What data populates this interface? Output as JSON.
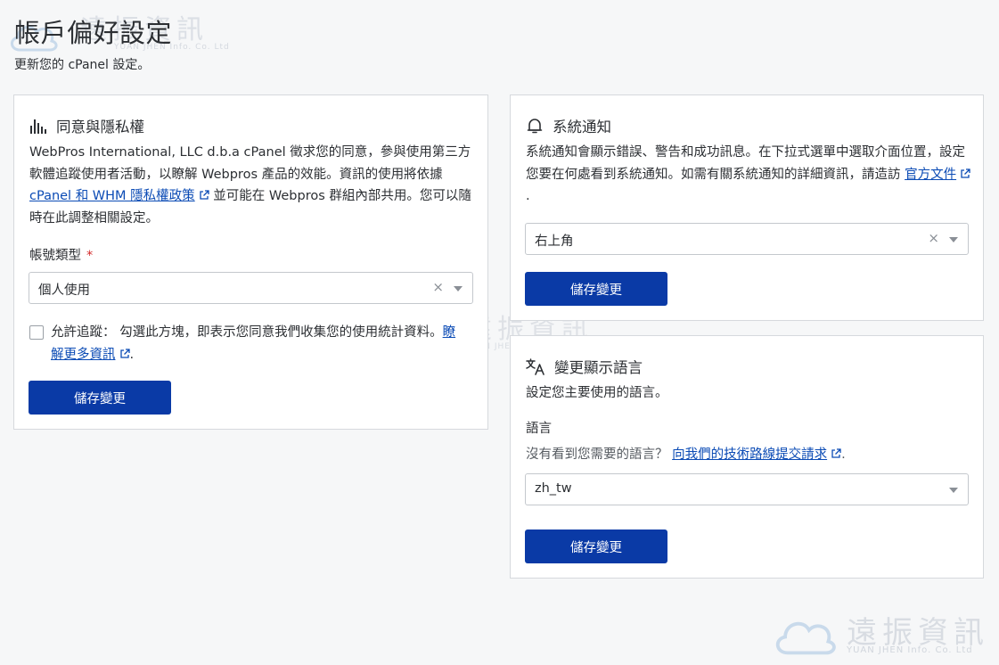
{
  "page": {
    "title": "帳戶偏好設定",
    "subtitle": "更新您的 cPanel 設定。"
  },
  "watermark": {
    "brand": "遠振資訊",
    "brand_en": "YUAN JHEN Info. Co. Ltd"
  },
  "consent": {
    "heading": "同意與隱私權",
    "desc_part1": "WebPros International, LLC d.b.a cPanel 徵求您的同意，參與使用第三方軟體追蹤使用者活動，以瞭解 Webpros 產品的效能。資訊的使用將依據",
    "policy_link": "cPanel 和 WHM 隱私權政策",
    "desc_part2": "並可能在 Webpros 群組內部共用。您可以隨時在此調整相關設定。",
    "account_type_label": "帳號類型",
    "required_mark": "*",
    "account_type_value": "個人使用",
    "clear_icon": "×",
    "allow_tracking_text": "允許追蹤： 勾選此方塊，即表示您同意我們收集您的使用統計資料。",
    "learn_more_link": "瞭解更多資訊",
    "learn_more_suffix": ".",
    "save_label": "儲存變更"
  },
  "notifications": {
    "heading": "系統通知",
    "desc": "系統通知會顯示錯誤、警告和成功訊息。在下拉式選單中選取介面位置，設定您要在何處看到系統通知。如需有關系統通知的詳細資訊，請造訪",
    "docs_link": "官方文件",
    "docs_suffix": ".",
    "position_value": "右上角",
    "clear_icon": "×",
    "save_label": "儲存變更"
  },
  "language": {
    "heading": "變更顯示語言",
    "desc": "設定您主要使用的語言。",
    "field_label": "語言",
    "missing_text": "沒有看到您需要的語言？",
    "request_link": "向我們的技術路線提交請求",
    "request_suffix": ".",
    "value": "zh_tw",
    "save_label": "儲存變更"
  },
  "icons": {
    "consent": "bar-chart-icon",
    "notifications": "bell-icon",
    "language": "translate-icon",
    "external": "external-link-icon"
  },
  "colors": {
    "primary_button": "#0a3aa6",
    "link": "#0b4bb5",
    "required": "#d42a2a",
    "background": "#f6f7f8"
  }
}
